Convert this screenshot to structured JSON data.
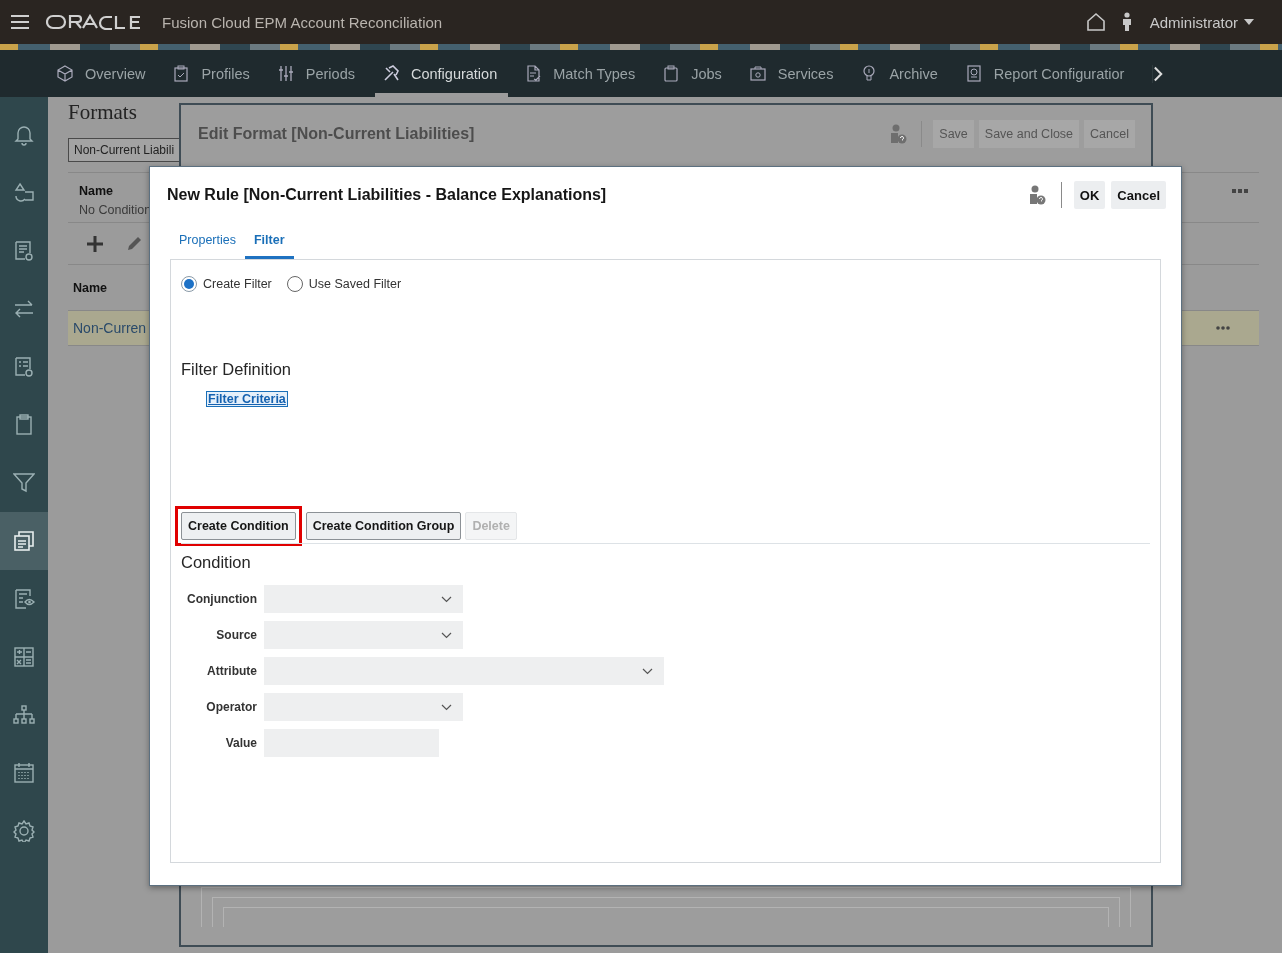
{
  "header": {
    "app_title": "Fusion Cloud EPM Account Reconciliation",
    "user": "Administrator"
  },
  "nav_tabs": [
    {
      "label": "Overview",
      "selected": false
    },
    {
      "label": "Profiles",
      "selected": false
    },
    {
      "label": "Periods",
      "selected": false
    },
    {
      "label": "Configuration",
      "selected": true
    },
    {
      "label": "Match Types",
      "selected": false
    },
    {
      "label": "Jobs",
      "selected": false
    },
    {
      "label": "Services",
      "selected": false
    },
    {
      "label": "Archive",
      "selected": false
    },
    {
      "label": "Report Configuratior",
      "selected": false
    }
  ],
  "sidebar": {
    "items": [
      {
        "selected": false
      },
      {
        "selected": false
      },
      {
        "selected": false
      },
      {
        "selected": false
      },
      {
        "selected": false
      },
      {
        "selected": false
      },
      {
        "selected": false
      },
      {
        "selected": true
      },
      {
        "selected": false
      },
      {
        "selected": false
      },
      {
        "selected": false
      },
      {
        "selected": false
      },
      {
        "selected": false
      }
    ]
  },
  "formats_page": {
    "title": "Formats",
    "search_value": "Non-Current Liabili",
    "conditions_table": {
      "columns": [
        "Name"
      ],
      "rows": [
        {
          "cells": [
            "No Condition"
          ]
        }
      ]
    },
    "formats_table": {
      "columns": [
        "Name"
      ],
      "rows": [
        {
          "cells": [
            "Non-Curren"
          ],
          "selected": true
        }
      ]
    }
  },
  "edit_format_dialog": {
    "title": "Edit Format [Non-Current Liabilities]",
    "buttons": [
      "Save",
      "Save and Close",
      "Cancel"
    ]
  },
  "new_rule_dialog": {
    "title": "New Rule [Non-Current Liabilities - Balance Explanations]",
    "buttons": [
      "OK",
      "Cancel"
    ],
    "tabs": [
      {
        "label": "Properties",
        "selected": false
      },
      {
        "label": "Filter",
        "selected": true
      }
    ],
    "filter_options": [
      {
        "label": "Create Filter",
        "selected": true
      },
      {
        "label": "Use Saved Filter",
        "selected": false
      }
    ],
    "filter_definition": {
      "heading": "Filter Definition",
      "criteria_link": "Filter Criteria"
    },
    "actions": [
      {
        "label": "Create Condition",
        "disabled": false,
        "highlighted": true
      },
      {
        "label": "Create Condition Group",
        "disabled": false,
        "highlighted": false
      },
      {
        "label": "Delete",
        "disabled": true,
        "highlighted": false
      }
    ],
    "condition": {
      "heading": "Condition",
      "fields": [
        {
          "label": "Conjunction",
          "kind": "select"
        },
        {
          "label": "Source",
          "kind": "select"
        },
        {
          "label": "Attribute",
          "kind": "wide_select"
        },
        {
          "label": "Operator",
          "kind": "select"
        },
        {
          "label": "Value",
          "kind": "text"
        }
      ]
    }
  }
}
